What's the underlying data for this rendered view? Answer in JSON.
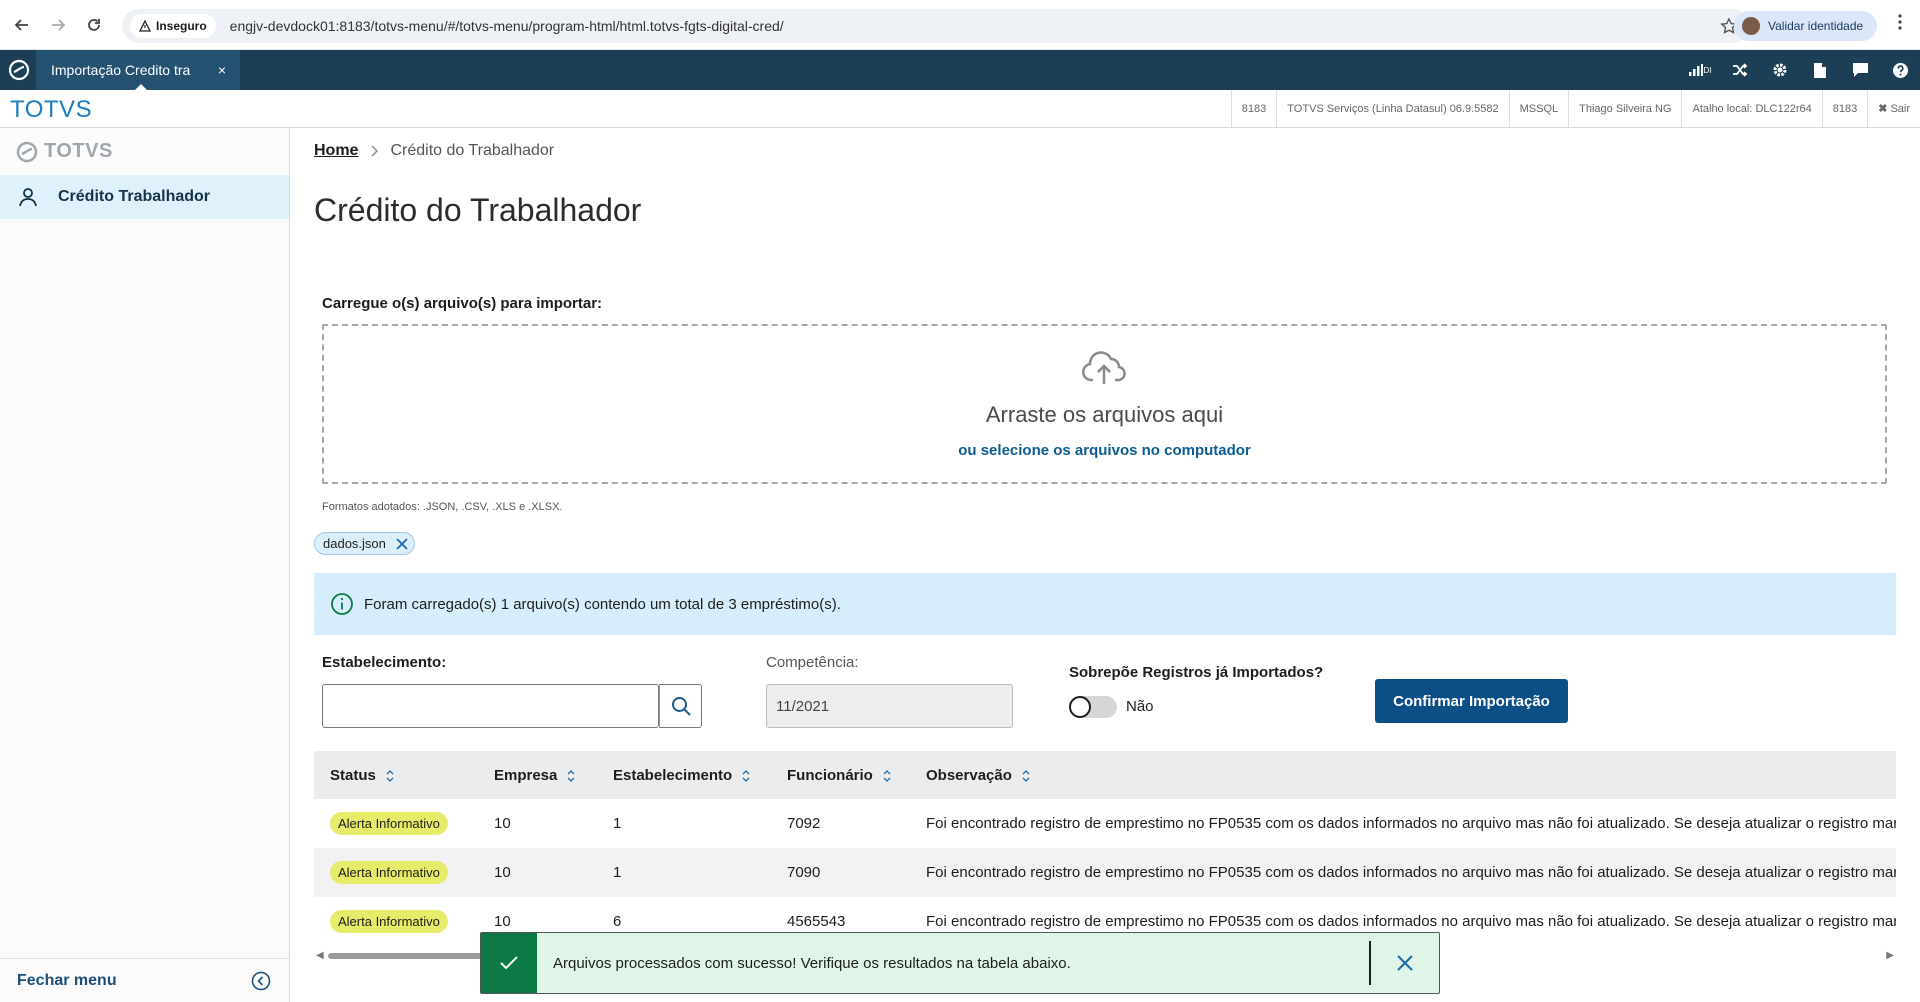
{
  "browser": {
    "insecure_label": "Inseguro",
    "url": "engjv-devdock01:8183/totvs-menu/#/totvs-menu/program-html/html.totvs-fgts-digital-cred/",
    "identity_label": "Validar identidade"
  },
  "app_header": {
    "tab_title": "Importação Credito tra",
    "tab_close": "×",
    "di_label": "DI"
  },
  "info_bar": {
    "brand": "TOTVS",
    "items": [
      "8183",
      "TOTVS Serviços (Linha Datasul) 06.9.5582",
      "MSSQL",
      "Thiago Silveira NG",
      "Atalho local: DLC122r64",
      "8183",
      "Sair"
    ]
  },
  "sidebar": {
    "logo_text": "TOTVS",
    "item_label": "Crédito Trabalhador",
    "footer_label": "Fechar menu"
  },
  "breadcrumb": {
    "home": "Home",
    "current": "Crédito do Trabalhador"
  },
  "page": {
    "title": "Crédito do Trabalhador"
  },
  "upload": {
    "label": "Carregue o(s) arquivo(s) para importar:",
    "drop_title": "Arraste os arquivos aqui",
    "drop_link": "ou selecione os arquivos no computador",
    "formats": "Formatos adotados: .JSON, .CSV, .XLS e .XLSX.",
    "file_name": "dados.json"
  },
  "alert": {
    "message": "Foram carregado(s) 1 arquivo(s) contendo um total de 3 empréstimo(s)."
  },
  "form": {
    "estab_label": "Estabelecimento:",
    "estab_value": "",
    "comp_label": "Competência:",
    "comp_value": "11/2021",
    "overwrite_label": "Sobrepõe Registros já Importados?",
    "overwrite_value": "Não",
    "confirm_label": "Confirmar Importação"
  },
  "table": {
    "columns": [
      "Status",
      "Empresa",
      "Estabelecimento",
      "Funcionário",
      "Observação"
    ],
    "rows": [
      {
        "status": "Alerta Informativo",
        "empresa": "10",
        "estab": "1",
        "func": "7092",
        "obs": "Foi encontrado registro de emprestimo no FP0535 com os dados informados no arquivo mas não foi atualizado. Se deseja atualizar o registro marque a opção sobrepor."
      },
      {
        "status": "Alerta Informativo",
        "empresa": "10",
        "estab": "1",
        "func": "7090",
        "obs": "Foi encontrado registro de emprestimo no FP0535 com os dados informados no arquivo mas não foi atualizado. Se deseja atualizar o registro marque a opção sobrepor."
      },
      {
        "status": "Alerta Informativo",
        "empresa": "10",
        "estab": "6",
        "func": "4565543",
        "obs": "Foi encontrado registro de emprestimo no FP0535 com os dados informados no arquivo mas não foi atualizado. Se deseja atualizar o registro marque a opção sobrepor."
      }
    ]
  },
  "toast": {
    "message": "Arquivos processados com sucesso! Verifique os resultados na tabela abaixo."
  },
  "colors": {
    "primary": "#0c4f87",
    "header": "#1c3f56",
    "success": "#0d7a45",
    "info_bg": "#d6eefb",
    "badge": "#e6eb6a"
  }
}
